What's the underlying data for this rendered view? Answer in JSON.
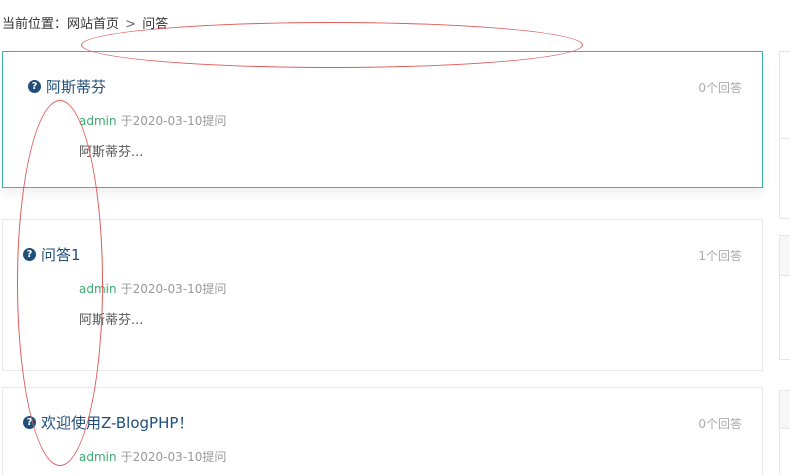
{
  "breadcrumb": {
    "prefix": "当前位置：",
    "home": "网站首页",
    "separator": ">",
    "current": "问答"
  },
  "questions": [
    {
      "title": "阿斯蒂芬",
      "answers": "0个回答",
      "author": "admin",
      "meta": "于2020-03-10提问",
      "excerpt": "阿斯蒂芬..."
    },
    {
      "title": "问答1",
      "answers": "1个回答",
      "author": "admin",
      "meta": "于2020-03-10提问",
      "excerpt": "阿斯蒂芬..."
    },
    {
      "title": "欢迎使用Z-BlogPHP！",
      "answers": "0个回答",
      "author": "admin",
      "meta": "于2020-03-10提问",
      "excerpt": ""
    }
  ],
  "icons": {
    "question": "question-circle-icon"
  },
  "colors": {
    "accent_border": "#3fb7a0",
    "title": "#1f4e79",
    "author": "#3aa76d",
    "annotation": "#e05a5a"
  }
}
